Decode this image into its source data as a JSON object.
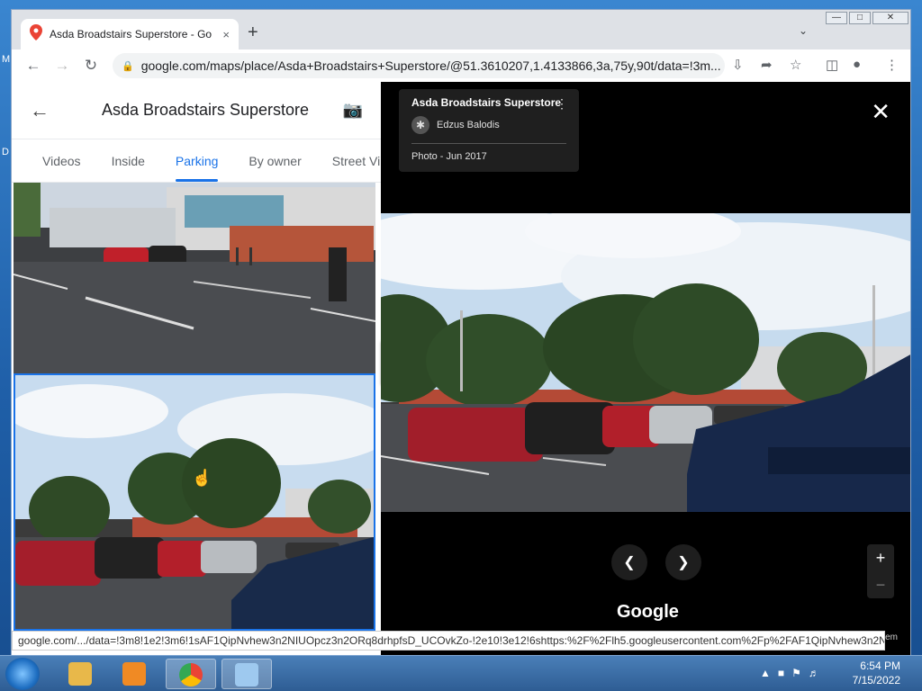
{
  "browser": {
    "tab_title": "Asda Broadstairs Superstore - Go",
    "tab_close": "×",
    "new_tab": "+",
    "url": "google.com/maps/place/Asda+Broadstairs+Superstore/@51.3610207,1.4133866,3a,75y,90t/data=!3m...",
    "status_url": "google.com/.../data=!3m8!1e2!3m6!1sAF1QipNvhew3n2NIUOpcz3n2ORq8drhpfsD_UCOvkZo-!2e10!3e12!6shttps:%2F%2Flh5.googleusercontent.com%2Fp%2FAF1QipNvhew3n2N..."
  },
  "place_panel": {
    "title": "Asda Broadstairs Superstore",
    "tabs": [
      {
        "label": "Videos"
      },
      {
        "label": "Inside"
      },
      {
        "label": "Parking"
      },
      {
        "label": "By owner"
      },
      {
        "label": "Street Vi"
      }
    ]
  },
  "viewer": {
    "place_name": "Asda Broadstairs Superstore",
    "author": "Edzus Balodis",
    "photo_date": "Photo - Jun 2017",
    "logo": "Google",
    "zoom_in": "+",
    "zoom_out": "−",
    "edge_text": "lem"
  },
  "taskbar": {
    "time": "6:54 PM",
    "date": "7/15/2022"
  },
  "desktop": {
    "edge_m": "M",
    "edge_d": "D"
  }
}
